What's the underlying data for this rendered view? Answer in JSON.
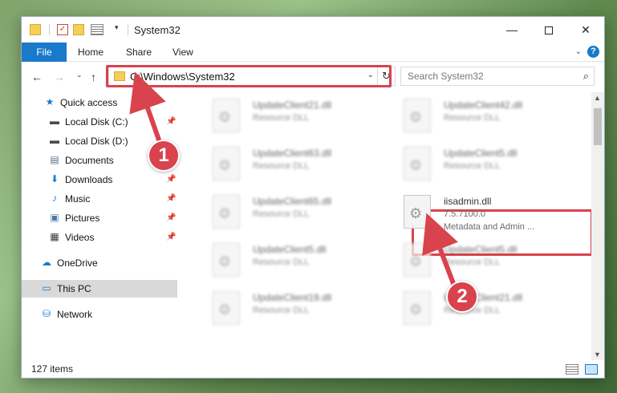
{
  "window": {
    "title": "System32"
  },
  "titlebar": {
    "minimize_glyph": "—",
    "close_glyph": "✕",
    "check_glyph": "✓",
    "dropdown_glyph": "▾"
  },
  "ribbon": {
    "tabs": [
      {
        "label": "File"
      },
      {
        "label": "Home"
      },
      {
        "label": "Share"
      },
      {
        "label": "View"
      }
    ],
    "expand_glyph": "⌄",
    "help_glyph": "?"
  },
  "navigation": {
    "back_glyph": "←",
    "forward_glyph": "→",
    "recent_glyph": "⌄",
    "up_glyph": "↑",
    "address": "C:\\Windows\\System32",
    "address_dropdown_glyph": "⌄",
    "refresh_glyph": "↻"
  },
  "search": {
    "placeholder": "Search System32",
    "icon_glyph": "⌕"
  },
  "sidebar": {
    "items": [
      {
        "label": "Quick access",
        "icon": "star-icon",
        "glyph": "★",
        "color": "#1979ca"
      },
      {
        "label": "Local Disk (C:)",
        "icon": "drive-icon",
        "glyph": "▬",
        "color": "#4a4a4a",
        "pin": "📌"
      },
      {
        "label": "Local Disk (D:)",
        "icon": "drive-icon",
        "glyph": "▬",
        "color": "#4a4a4a"
      },
      {
        "label": "Documents",
        "icon": "document-icon",
        "glyph": "▤",
        "color": "#5a6f8a"
      },
      {
        "label": "Downloads",
        "icon": "download-icon",
        "glyph": "⬇",
        "color": "#1979ca",
        "pin": "📌"
      },
      {
        "label": "Music",
        "icon": "music-icon",
        "glyph": "♪",
        "color": "#1979ca",
        "pin": "📌"
      },
      {
        "label": "Pictures",
        "icon": "pictures-icon",
        "glyph": "▣",
        "color": "#4a7aa8",
        "pin": "📌"
      },
      {
        "label": "Videos",
        "icon": "video-icon",
        "glyph": "▦",
        "color": "#3a3a3a",
        "pin": "📌"
      },
      {
        "label": "OneDrive",
        "icon": "cloud-icon",
        "glyph": "☁",
        "color": "#1979ca"
      },
      {
        "label": "This PC",
        "icon": "computer-icon",
        "glyph": "▭",
        "color": "#1979ca",
        "selected": true
      },
      {
        "label": "Network",
        "icon": "network-icon",
        "glyph": "⛁",
        "color": "#1979ca"
      }
    ]
  },
  "files": [
    {
      "name": "UpdateClient21.dll",
      "sub": "Resource DLL",
      "blurred": true
    },
    {
      "name": "UpdateClient42.dll",
      "sub": "Resource DLL",
      "blurred": true
    },
    {
      "name": "UpdateClient63.dll",
      "sub": "Resource DLL",
      "blurred": true
    },
    {
      "name": "UpdateClient5.dll",
      "sub": "Resource DLL",
      "blurred": true
    },
    {
      "name": "UpdateClient65.dll",
      "sub": "Resource DLL",
      "blurred": true
    },
    {
      "name": "iisadmin.dll",
      "sub": "7.5.7100.0",
      "sub2": "Metadata and Admin ...",
      "blurred": false
    },
    {
      "name": "UpdateClient5.dll",
      "sub": "Resource DLL",
      "blurred": true
    },
    {
      "name": "UpdateClient5.dll",
      "sub": "Resource DLL",
      "blurred": true
    },
    {
      "name": "UpdateClient19.dll",
      "sub": "Resource DLL",
      "blurred": true
    },
    {
      "name": "UpdateClient21.dll",
      "sub": "Resource DLL",
      "blurred": true
    }
  ],
  "scrollbar": {
    "up_glyph": "▲",
    "down_glyph": "▼"
  },
  "status": {
    "item_count": "127 items"
  },
  "steps": {
    "one": "1",
    "two": "2"
  },
  "colors": {
    "accent": "#1979ca",
    "highlight": "#d9434d"
  }
}
